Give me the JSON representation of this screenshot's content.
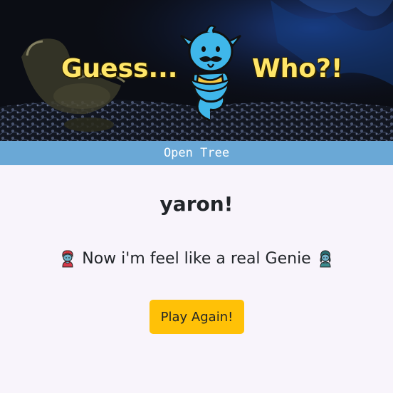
{
  "header": {
    "title_left": "Guess...",
    "title_right": "Who?!"
  },
  "nav": {
    "link_label": "Open Tree"
  },
  "result": {
    "player_name": "yaron!",
    "message": "Now i'm feel like a real Genie"
  },
  "actions": {
    "play_again_label": "Play Again!"
  },
  "colors": {
    "nav_bg": "#6aa8d6",
    "button_bg": "#ffc107",
    "title_yellow": "#ffe668",
    "genie_blue": "#3fb7ea"
  },
  "icons": [
    "lamp-background",
    "genie-logo",
    "man-genie-emoji",
    "woman-genie-emoji"
  ]
}
